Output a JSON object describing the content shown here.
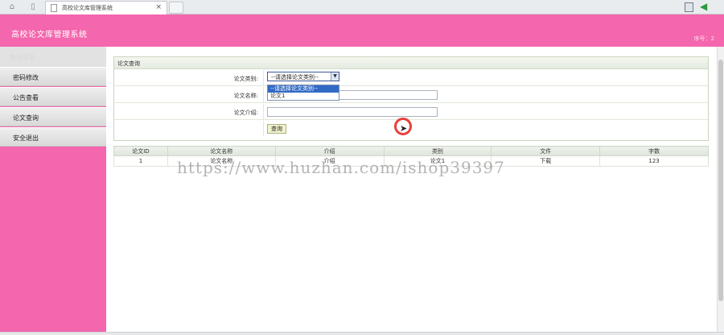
{
  "browser": {
    "tab_title": "高校论文库管理系统",
    "tab_close": "×",
    "back_glyph": "◀"
  },
  "header": {
    "app_title": "高校论文库管理系统",
    "user_info": "序号：2"
  },
  "sidebar": {
    "head_label": "管理菜单",
    "items": [
      {
        "label": "密码修改"
      },
      {
        "label": "公告查看"
      },
      {
        "label": "论文查询"
      },
      {
        "label": "安全退出"
      }
    ]
  },
  "search_panel": {
    "title": "论文查询",
    "category_label": "论文类别:",
    "category_select": {
      "selected": "--请选择论文类别--",
      "options": [
        "--请选择论文类别--",
        "论文1"
      ]
    },
    "name_label": "论文名称:",
    "name_value": "",
    "intro_label": "论文介绍:",
    "intro_value": "",
    "query_button": "查询"
  },
  "results_table": {
    "columns": [
      "论文ID",
      "论文名称",
      "介绍",
      "类别",
      "文件",
      "字数"
    ],
    "rows": [
      [
        "1",
        "论文名称",
        "介绍",
        "论文1",
        "下载",
        "123"
      ]
    ]
  },
  "watermark": "https://www.huzhan.com/ishop39397",
  "colors": {
    "header_pink": "#f466ad",
    "select_highlight": "#316ac5"
  }
}
